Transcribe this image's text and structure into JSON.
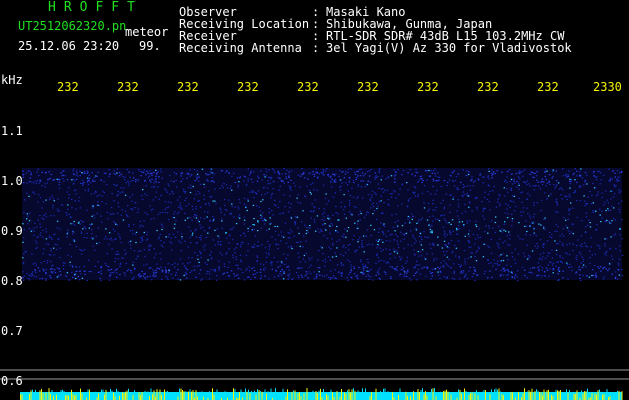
{
  "header": {
    "brand": "HROFFT",
    "filename": "UT2512062320.pn",
    "mode": "meteor",
    "timestamp": "25.12.06 23:20",
    "value": "99."
  },
  "info": {
    "rows": [
      {
        "label": "Observer",
        "value": "Masaki Kano"
      },
      {
        "label": "Receiving Location",
        "value": "Shibukawa, Gunma, Japan"
      },
      {
        "label": "Receiver",
        "value": "RTL-SDR SDR# 43dB L15 103.2MHz CW"
      },
      {
        "label": "Receiving Antenna",
        "value": "3el Yagi(V) Az 330 for Vladivostok"
      }
    ],
    "separator": ":"
  },
  "axis": {
    "unit": "kHz",
    "y_ticks": [
      "1.1",
      "1.0",
      "0.9",
      "0.8",
      "0.7",
      "0.6"
    ],
    "x_ticks": [
      "232",
      "232",
      "232",
      "232",
      "232",
      "232",
      "232",
      "232",
      "232",
      "2330"
    ]
  },
  "colors": {
    "background": "#000000",
    "text_header": "#1fe01f",
    "text_info": "#ffffff",
    "time_labels": "#f5f500",
    "signal_low": "#1a2ab0",
    "signal_high": "#30c8ff",
    "bottom_strip": "#00e0ff"
  }
}
